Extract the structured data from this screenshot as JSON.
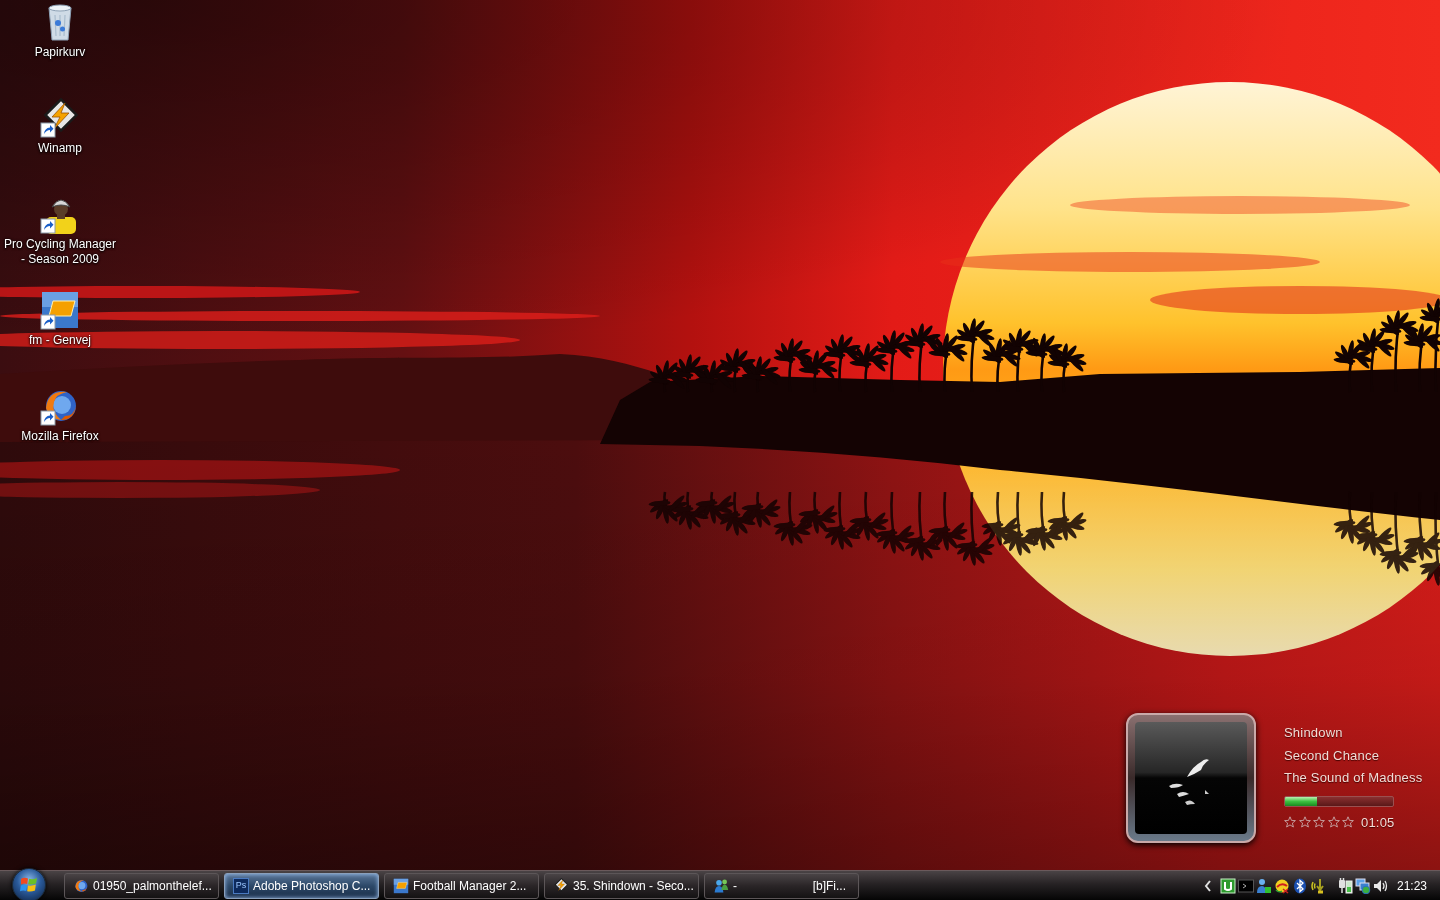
{
  "desktop_items": [
    {
      "kind": "trash",
      "label": "Papirkurv",
      "shortcut": false
    },
    {
      "kind": "lightning",
      "label": "Winamp",
      "shortcut": true
    },
    {
      "kind": "cyclist",
      "label": "Pro Cycling Manager - Season 2009",
      "shortcut": true
    },
    {
      "kind": "tile",
      "label": "fm - Genvej",
      "shortcut": true
    },
    {
      "kind": "globe",
      "label": "Mozilla Firefox",
      "shortcut": true
    }
  ],
  "media_widget": {
    "artist": "Shindown",
    "track": "Second Chance",
    "album": "The Sound of Madness",
    "level": 0.3,
    "stars": 0,
    "time": "01:05"
  },
  "taskbar": {
    "buttons": [
      {
        "kind": "globe",
        "label": "01950_palmonthelef...",
        "selected": false
      },
      {
        "kind": "logo",
        "icon_text": "Ps",
        "label": "Adobe Photoshop C...",
        "selected": true
      },
      {
        "kind": "tile",
        "label": "Football Manager 2...",
        "selected": false
      },
      {
        "kind": "lightning",
        "label": "35. Shindown - Seco...",
        "selected": false
      },
      {
        "kind": "people",
        "label": "-",
        "label_2": "[b]Fi...",
        "selected": false
      }
    ],
    "notification_icons": [
      {
        "kind": "tile"
      },
      {
        "kind": "terminal"
      },
      {
        "kind": "person"
      },
      {
        "kind": "ball"
      },
      {
        "kind": "bluetooth"
      },
      {
        "kind": "download"
      }
    ],
    "system_icons": [
      {
        "kind": "plug"
      },
      {
        "kind": "network"
      },
      {
        "kind": "volume"
      }
    ],
    "clock": "21:23"
  }
}
